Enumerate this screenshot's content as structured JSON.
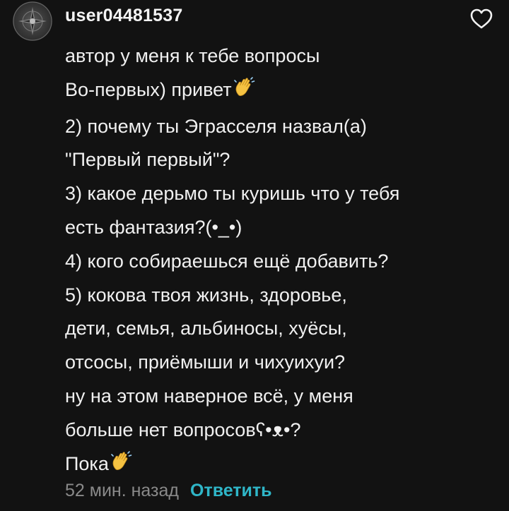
{
  "comment": {
    "avatar_icon": "user-avatar-emblem",
    "username": "user04481537",
    "like_icon": "heart-outline-icon",
    "lines": [
      "автор у меня к тебе вопросы",
      "Во-первых) привет",
      "2) почему ты Эграсселя назвал(а)",
      "\"Первый первый\"?",
      "3) какое дерьмо ты куришь что у тебя",
      "есть фантазия?(•_•)",
      "4) кого собираешься ещё добавить?",
      "5) кокова твоя жизнь, здоровье,",
      "дети, семья, альбиносы, хуёсы,",
      "отсосы, приёмыши и чихуихуи?",
      "ну на этом наверное всё, у меня",
      "больше нет вопросовʕ•ᴥ•?",
      "Пока"
    ],
    "emoji_icon": "waving-hand-emoji",
    "timestamp": "52 мин. назад",
    "reply_label": "Ответить"
  },
  "colors": {
    "background": "#121212",
    "text": "#f0f0f0",
    "muted": "#8a8a8a",
    "accent": "#2fb6c8",
    "emoji": "#f5c242"
  }
}
